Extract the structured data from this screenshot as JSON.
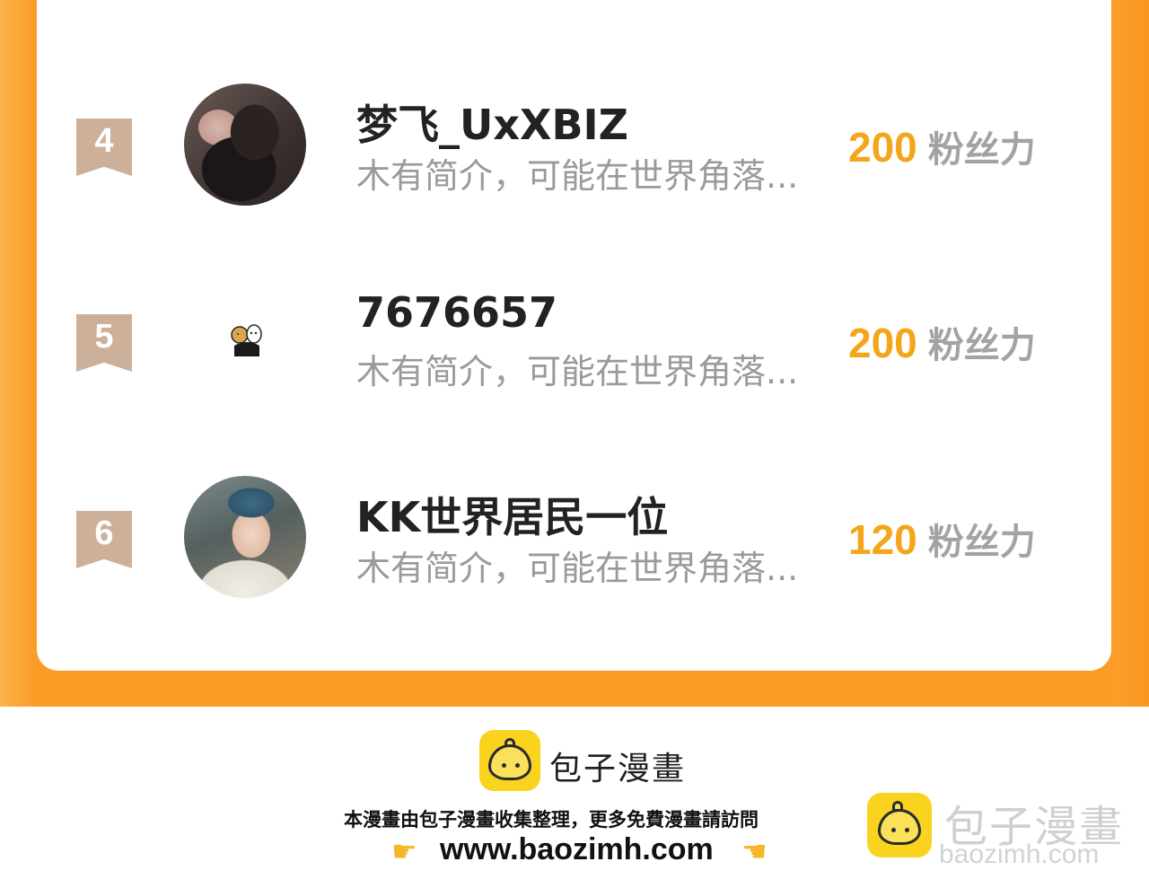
{
  "ranking": {
    "entries": [
      {
        "rank": "4",
        "name": "梦飞_UxXBIZ",
        "bio": "木有简介，可能在世界角落...",
        "fans_value": "200",
        "fans_unit": "粉丝力"
      },
      {
        "rank": "5",
        "name": "7676657",
        "bio": "木有简介，可能在世界角落...",
        "fans_value": "200",
        "fans_unit": "粉丝力"
      },
      {
        "rank": "6",
        "name": "KK世界居民一位",
        "bio": "木有简介，可能在世界角落...",
        "fans_value": "120",
        "fans_unit": "粉丝力"
      }
    ]
  },
  "footer": {
    "brand": "包子漫畫",
    "description": "本漫畫由包子漫畫收集整理，更多免費漫畫請訪問",
    "url": "www.baozimh.com",
    "watermark_brand": "包子漫畫",
    "watermark_url": "baozimh.com"
  },
  "colors": {
    "frame": "#fb9c25",
    "fans_value": "#f4a61b",
    "rank_badge": "#cdb09a",
    "logo": "#f9d31d"
  }
}
